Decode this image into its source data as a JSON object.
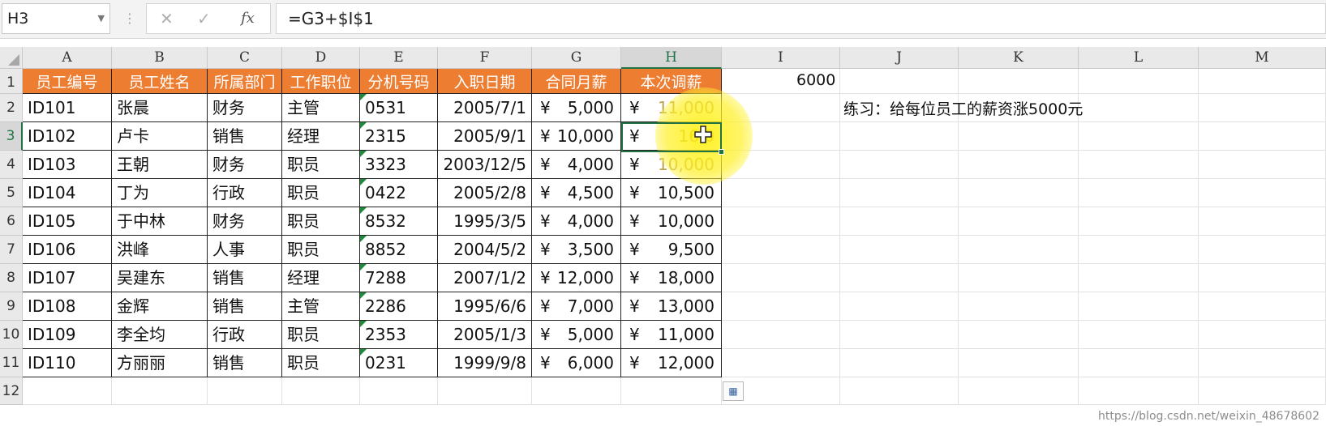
{
  "formula_bar": {
    "name_box": "H3",
    "cancel_icon": "close-icon",
    "enter_icon": "check-icon",
    "fx_label": "fx",
    "formula": "=G3+$I$1"
  },
  "columns": [
    "A",
    "B",
    "C",
    "D",
    "E",
    "F",
    "G",
    "H",
    "I",
    "J",
    "K",
    "L",
    "M"
  ],
  "rows": [
    "1",
    "2",
    "3",
    "4",
    "5",
    "6",
    "7",
    "8",
    "9",
    "10",
    "11",
    "12"
  ],
  "selected_cell": {
    "column": "H",
    "row": "3"
  },
  "table": {
    "header_color": "#ed7d31",
    "headers": [
      "员工编号",
      "员工姓名",
      "所属部门",
      "工作职位",
      "分机号码",
      "入职日期",
      "合同月薪",
      "本次调薪"
    ],
    "currency_symbol": "¥",
    "records": [
      {
        "id": "ID101",
        "name": "张晨",
        "dept": "财务",
        "title": "主管",
        "ext": "0531",
        "date": "2005/7/1",
        "salary": "5,000",
        "adjusted": "11,000"
      },
      {
        "id": "ID102",
        "name": "卢卡",
        "dept": "销售",
        "title": "经理",
        "ext": "2315",
        "date": "2005/9/1",
        "salary": "10,000",
        "adjusted": "16,0"
      },
      {
        "id": "ID103",
        "name": "王朝",
        "dept": "财务",
        "title": "职员",
        "ext": "3323",
        "date": "2003/12/5",
        "salary": "4,000",
        "adjusted": "10,000"
      },
      {
        "id": "ID104",
        "name": "丁为",
        "dept": "行政",
        "title": "职员",
        "ext": "0422",
        "date": "2005/2/8",
        "salary": "4,500",
        "adjusted": "10,500"
      },
      {
        "id": "ID105",
        "name": "于中林",
        "dept": "财务",
        "title": "职员",
        "ext": "8532",
        "date": "1995/3/5",
        "salary": "4,000",
        "adjusted": "10,000"
      },
      {
        "id": "ID106",
        "name": "洪峰",
        "dept": "人事",
        "title": "职员",
        "ext": "8852",
        "date": "2004/5/2",
        "salary": "3,500",
        "adjusted": "9,500"
      },
      {
        "id": "ID107",
        "name": "吴建东",
        "dept": "销售",
        "title": "经理",
        "ext": "7288",
        "date": "2007/1/2",
        "salary": "12,000",
        "adjusted": "18,000"
      },
      {
        "id": "ID108",
        "name": "金辉",
        "dept": "销售",
        "title": "主管",
        "ext": "2286",
        "date": "1995/6/6",
        "salary": "7,000",
        "adjusted": "13,000"
      },
      {
        "id": "ID109",
        "name": "李全均",
        "dept": "行政",
        "title": "职员",
        "ext": "2353",
        "date": "2005/1/3",
        "salary": "5,000",
        "adjusted": "11,000"
      },
      {
        "id": "ID110",
        "name": "方丽丽",
        "dept": "销售",
        "title": "职员",
        "ext": "0231",
        "date": "1999/9/8",
        "salary": "6,000",
        "adjusted": "12,000"
      }
    ]
  },
  "cell_I1": "6000",
  "exercise_note": "练习：给每位员工的薪资涨5000元",
  "paste_options_icon": "paste-options-icon",
  "watermark": "https://blog.csdn.net/weixin_48678602"
}
